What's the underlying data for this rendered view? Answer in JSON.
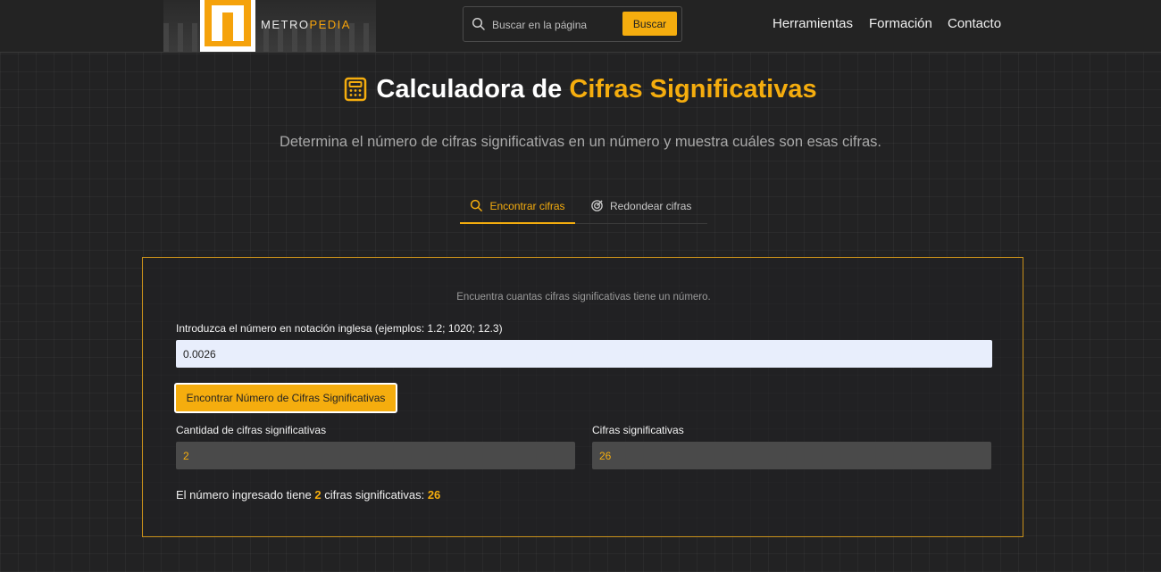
{
  "header": {
    "logo_text_1": "METRO",
    "logo_text_2": "PEDIA",
    "search_placeholder": "Buscar en la página",
    "search_button": "Buscar",
    "nav": [
      "Herramientas",
      "Formación",
      "Contacto"
    ]
  },
  "page": {
    "title_1": "Calculadora de ",
    "title_2": "Cifras Significativas",
    "subtitle": "Determina el número de cifras significativas en un número y muestra cuáles son esas cifras."
  },
  "tabs": [
    {
      "label": "Encontrar cifras",
      "icon": "search-icon",
      "active": true
    },
    {
      "label": "Redondear cifras",
      "icon": "target-icon",
      "active": false
    }
  ],
  "panel": {
    "description": "Encuentra cuantas cifras significativas tiene un número.",
    "input_label": "Introduzca el número en notación inglesa (ejemplos: 1.2; 1020; 12.3)",
    "input_value": "0.0026",
    "button_label": "Encontrar Número de Cifras Significativas",
    "count_label": "Cantidad de cifras significativas",
    "count_value": "2",
    "digits_label": "Cifras significativas",
    "digits_value": "26",
    "result_prefix": "El número ingresado tiene ",
    "result_count": "2",
    "result_middle": " cifras significativas: ",
    "result_digits": "26"
  },
  "colors": {
    "accent": "#f5ad0e",
    "background": "#222223",
    "input_bg": "#e8eefc",
    "output_bg": "#4a4a4a"
  }
}
